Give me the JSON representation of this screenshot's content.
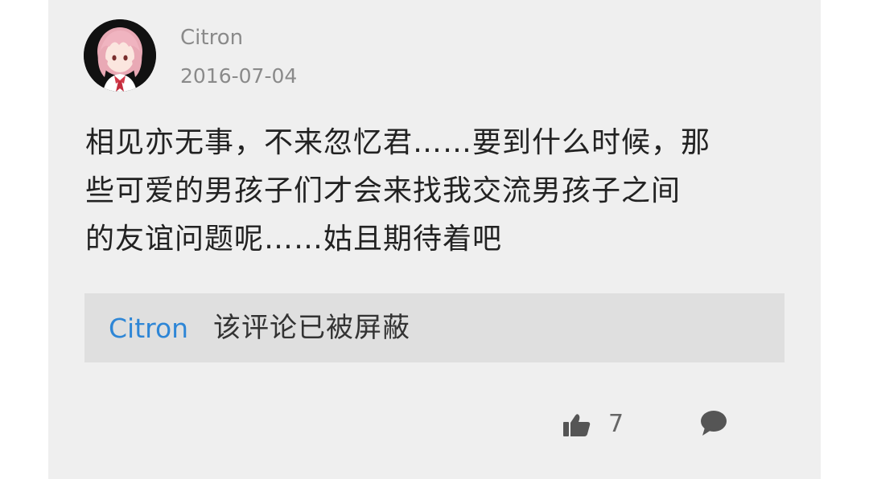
{
  "post": {
    "username": "Citron",
    "date": "2016-07-04",
    "lines": [
      "相见亦无事，不来忽忆君……要到什么时候，那",
      "些可爱的男孩子们才会来找我交流男孩子之间",
      "的友谊问题呢……姑且期待着吧"
    ]
  },
  "reply": {
    "username": "Citron",
    "text": "该评论已被屏蔽"
  },
  "actions": {
    "like_count": "7",
    "like_icon": "thumbs-up-icon",
    "comment_icon": "comment-bubble-icon"
  },
  "colors": {
    "card_bg": "#efefef",
    "reply_bg": "#dfdfdf",
    "link": "#2e86d6",
    "muted": "#8a8a8a"
  }
}
